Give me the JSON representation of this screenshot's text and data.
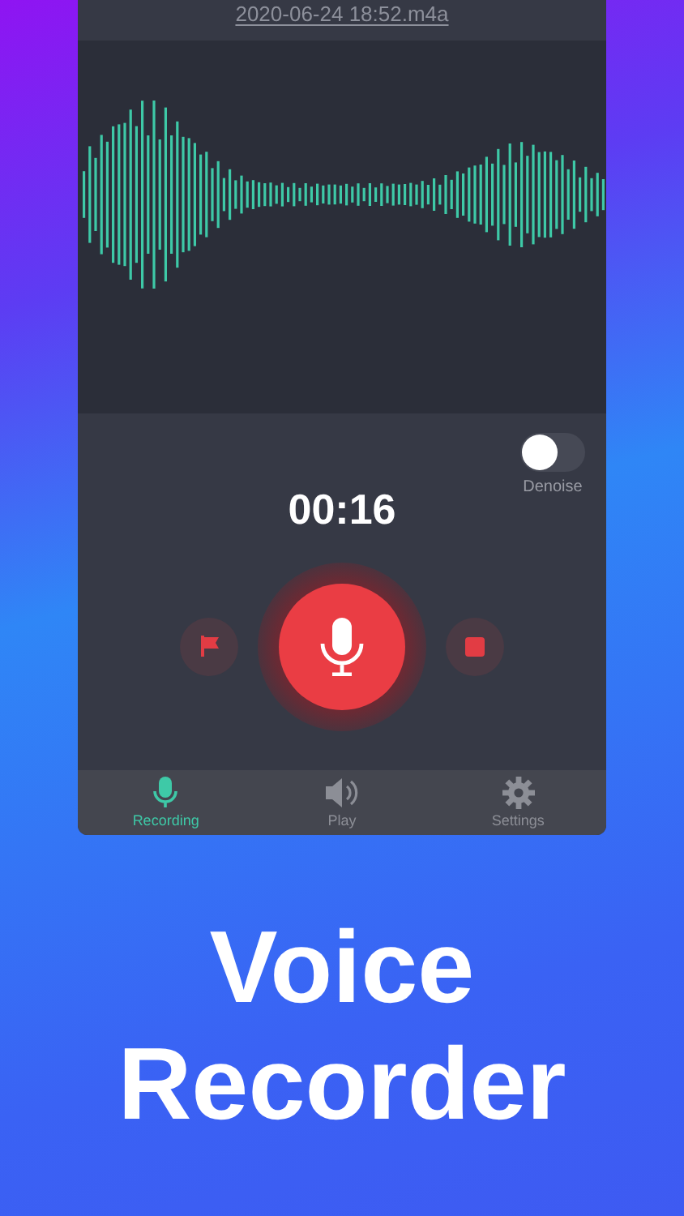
{
  "file_name": "2020-06-24 18:52.m4a",
  "timer": "00:16",
  "denoise": {
    "label": "Denoise",
    "on": false
  },
  "tabs": [
    {
      "kind": "mic",
      "label": "Recording",
      "selected": true
    },
    {
      "kind": "speaker",
      "label": "Play",
      "selected": false
    },
    {
      "kind": "gear",
      "label": "Settings",
      "selected": false
    }
  ],
  "headline": [
    "Voice",
    "Recorder"
  ]
}
